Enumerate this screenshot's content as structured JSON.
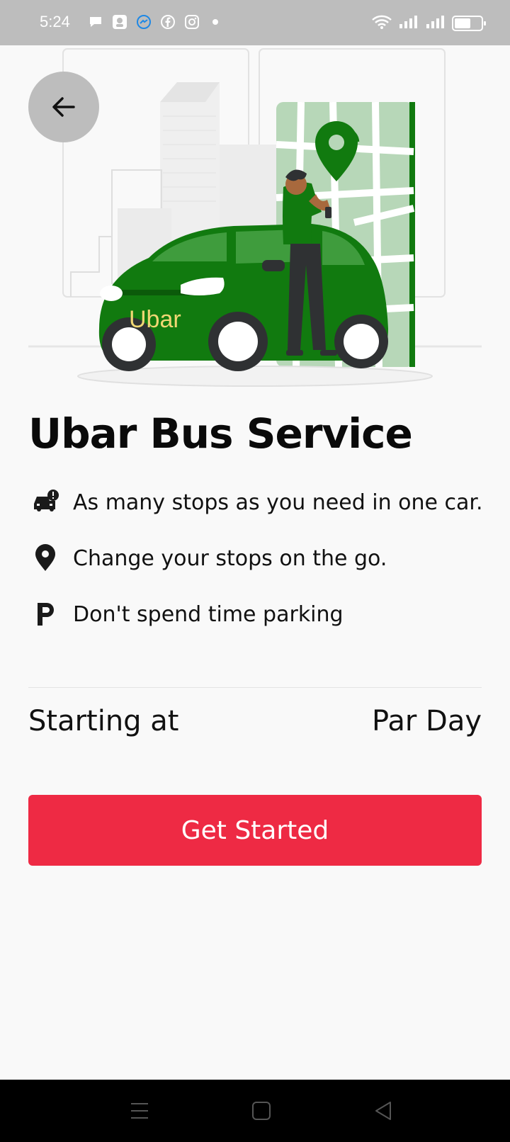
{
  "status_bar": {
    "time": "5:24",
    "left_icons": [
      "chat-bubble-icon",
      "app-notification-icon",
      "messenger-icon",
      "facebook-icon",
      "instagram-icon",
      "more-dot-icon"
    ],
    "right_icons": [
      "wifi-icon",
      "signal-1-icon",
      "signal-2-icon",
      "battery-icon"
    ],
    "battery_level": 0.55
  },
  "hero": {
    "brand_text": "Ubar",
    "colors": {
      "car": "#117a0f",
      "map": "#b7d7b8",
      "pin": "#117a0f",
      "brand_text": "#f0d774"
    }
  },
  "back_button": {
    "icon": "arrow-left-icon"
  },
  "title": "Ubar Bus Service",
  "features": [
    {
      "icon": "car-alert-icon",
      "text": "As many stops as you need in one car."
    },
    {
      "icon": "location-pin-icon",
      "text": "Change your stops on the go."
    },
    {
      "icon": "parking-icon",
      "text": "Don't spend time parking"
    }
  ],
  "pricing": {
    "label": "Starting at",
    "unit": "Par Day"
  },
  "cta": {
    "label": "Get Started",
    "color": "#ee2a44"
  },
  "nav_bar": {
    "icons": [
      "menu-icon",
      "home-icon",
      "back-icon"
    ]
  }
}
